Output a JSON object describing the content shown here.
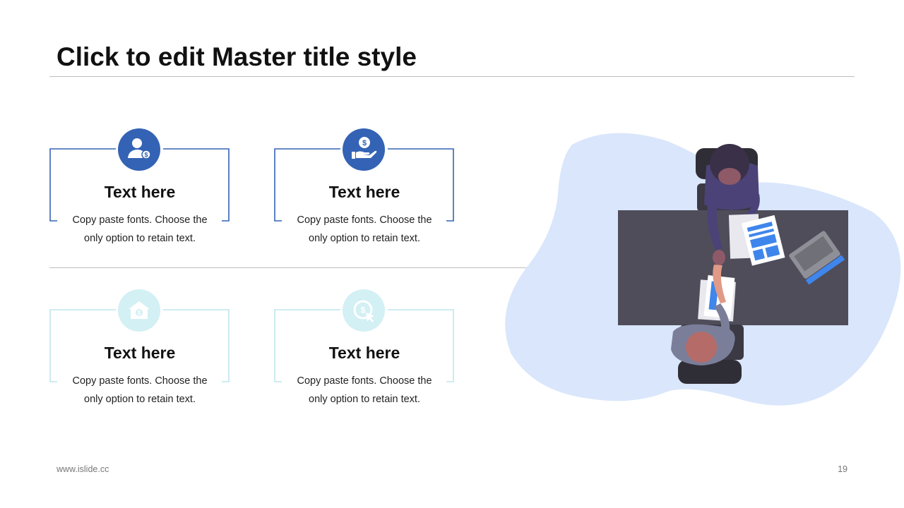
{
  "title": "Click to edit Master title style",
  "colors": {
    "accent": "#3463b5",
    "light_accent": "#d3f0f4",
    "frame_light": "#bfe6ee",
    "blob": "#d9e6fb",
    "desk": "#4f4d5a",
    "highlight": "#3f86ec"
  },
  "cards": [
    {
      "icon": "businessman-dollar-icon",
      "title": "Text here",
      "body": "Copy paste fonts. Choose the only option to retain text."
    },
    {
      "icon": "hand-coin-icon",
      "title": "Text here",
      "body": "Copy paste fonts. Choose the only option to retain text."
    },
    {
      "icon": "house-dollar-icon",
      "title": "Text here",
      "body": "Copy paste fonts. Choose the only option to retain text."
    },
    {
      "icon": "coin-cursor-icon",
      "title": "Text here",
      "body": "Copy paste fonts. Choose the only option to retain text."
    }
  ],
  "footer": {
    "url": "www.islide.cc",
    "page": "19"
  }
}
